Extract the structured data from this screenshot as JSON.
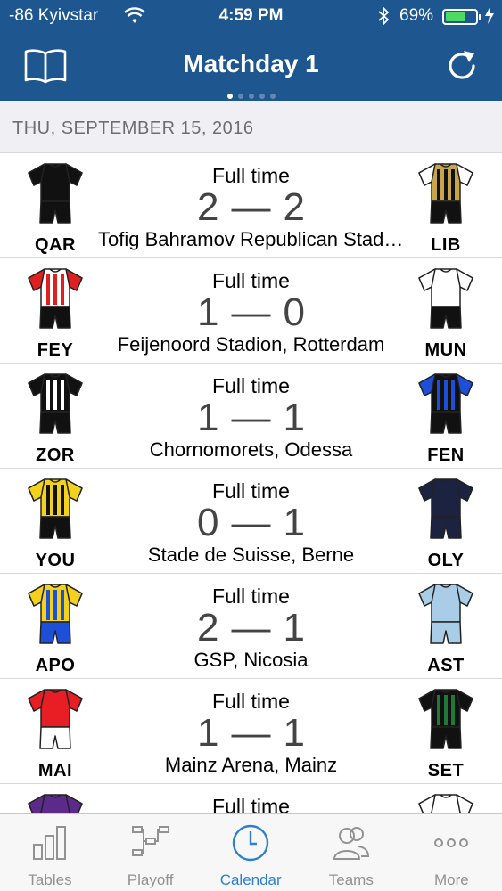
{
  "status_bar": {
    "carrier": "-86 Kyivstar",
    "time": "4:59 PM",
    "battery": "69%",
    "battery_level": 0.69
  },
  "nav": {
    "title": "Matchday 1",
    "left_icon": "book-icon",
    "right_icon": "refresh-icon",
    "page_dots": 5,
    "active_dot": 0
  },
  "section_header": "THU, SEPTEMBER 15, 2016",
  "matches": [
    {
      "home": "QAR",
      "away": "LIB",
      "status": "Full time",
      "home_score": "2",
      "away_score": "2",
      "venue": "Tofig Bahramov Republican Stadium, Baku",
      "home_kit": {
        "body": "#111111",
        "sleeve": "#111111",
        "shorts": "#111111",
        "stripe": ""
      },
      "away_kit": {
        "body": "#c9a54a",
        "sleeve": "#ffffff",
        "shorts": "#111111",
        "stripe": "#111111"
      }
    },
    {
      "home": "FEY",
      "away": "MUN",
      "status": "Full time",
      "home_score": "1",
      "away_score": "0",
      "venue": "Feijenoord Stadion, Rotterdam",
      "home_kit": {
        "body": "#ffffff",
        "sleeve": "#e02020",
        "shorts": "#111111",
        "stripe": "#e02020"
      },
      "away_kit": {
        "body": "#ffffff",
        "sleeve": "#ffffff",
        "shorts": "#111111",
        "stripe": ""
      }
    },
    {
      "home": "ZOR",
      "away": "FEN",
      "status": "Full time",
      "home_score": "1",
      "away_score": "1",
      "venue": "Chornomorets, Odessa",
      "home_kit": {
        "body": "#111111",
        "sleeve": "#111111",
        "shorts": "#111111",
        "stripe": "#ffffff"
      },
      "away_kit": {
        "body": "#111111",
        "sleeve": "#1e4fd8",
        "shorts": "#111111",
        "stripe": "#1e4fd8"
      }
    },
    {
      "home": "YOU",
      "away": "OLY",
      "status": "Full time",
      "home_score": "0",
      "away_score": "1",
      "venue": "Stade de Suisse, Berne",
      "home_kit": {
        "body": "#f2d21c",
        "sleeve": "#f2d21c",
        "shorts": "#111111",
        "stripe": "#111111"
      },
      "away_kit": {
        "body": "#1b2340",
        "sleeve": "#1b2340",
        "shorts": "#1b2340",
        "stripe": ""
      }
    },
    {
      "home": "APO",
      "away": "AST",
      "status": "Full time",
      "home_score": "2",
      "away_score": "1",
      "venue": "GSP, Nicosia",
      "home_kit": {
        "body": "#f2d21c",
        "sleeve": "#f2d21c",
        "shorts": "#1e4fd8",
        "stripe": "#1e4fd8"
      },
      "away_kit": {
        "body": "#a9cde6",
        "sleeve": "#a9cde6",
        "shorts": "#a9cde6",
        "stripe": ""
      }
    },
    {
      "home": "MAI",
      "away": "SET",
      "status": "Full time",
      "home_score": "1",
      "away_score": "1",
      "venue": "Mainz Arena, Mainz",
      "home_kit": {
        "body": "#e81e25",
        "sleeve": "#e81e25",
        "shorts": "#ffffff",
        "stripe": ""
      },
      "away_kit": {
        "body": "#111111",
        "sleeve": "#111111",
        "shorts": "#111111",
        "stripe": "#1f7a3a"
      }
    },
    {
      "home": "",
      "away": "",
      "status": "Full time",
      "home_score": "",
      "away_score": "",
      "venue": "",
      "home_kit": {
        "body": "#5b2a8a",
        "sleeve": "#5b2a8a",
        "shorts": "#5b2a8a",
        "stripe": ""
      },
      "away_kit": {
        "body": "#ffffff",
        "sleeve": "#ffffff",
        "shorts": "#ffffff",
        "stripe": ""
      }
    }
  ],
  "tabs": [
    {
      "label": "Tables",
      "icon": "bar-chart-icon",
      "active": false
    },
    {
      "label": "Playoff",
      "icon": "bracket-icon",
      "active": false
    },
    {
      "label": "Calendar",
      "icon": "clock-icon",
      "active": true
    },
    {
      "label": "Teams",
      "icon": "people-icon",
      "active": false
    },
    {
      "label": "More",
      "icon": "more-dots-icon",
      "active": false
    }
  ],
  "colors": {
    "nav_bg": "#1e5690",
    "active_tab": "#2f7fd1",
    "inactive_tab": "#929292",
    "section_bg": "#efeff4"
  }
}
